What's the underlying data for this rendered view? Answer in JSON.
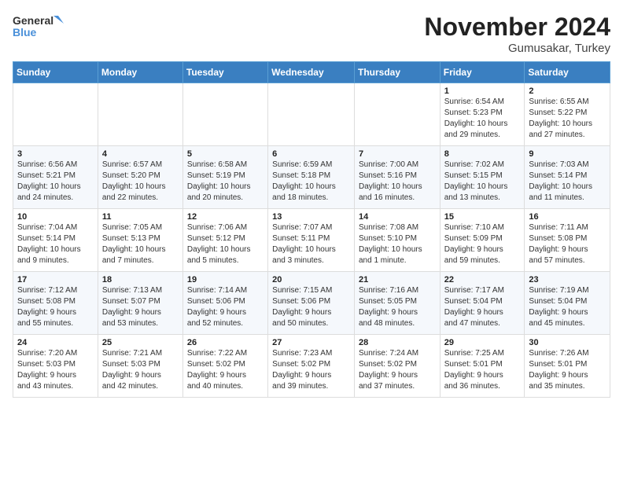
{
  "logo": {
    "line1": "General",
    "line2": "Blue"
  },
  "title": "November 2024",
  "subtitle": "Gumusakar, Turkey",
  "headers": [
    "Sunday",
    "Monday",
    "Tuesday",
    "Wednesday",
    "Thursday",
    "Friday",
    "Saturday"
  ],
  "weeks": [
    [
      {
        "day": "",
        "info": ""
      },
      {
        "day": "",
        "info": ""
      },
      {
        "day": "",
        "info": ""
      },
      {
        "day": "",
        "info": ""
      },
      {
        "day": "",
        "info": ""
      },
      {
        "day": "1",
        "info": "Sunrise: 6:54 AM\nSunset: 5:23 PM\nDaylight: 10 hours\nand 29 minutes."
      },
      {
        "day": "2",
        "info": "Sunrise: 6:55 AM\nSunset: 5:22 PM\nDaylight: 10 hours\nand 27 minutes."
      }
    ],
    [
      {
        "day": "3",
        "info": "Sunrise: 6:56 AM\nSunset: 5:21 PM\nDaylight: 10 hours\nand 24 minutes."
      },
      {
        "day": "4",
        "info": "Sunrise: 6:57 AM\nSunset: 5:20 PM\nDaylight: 10 hours\nand 22 minutes."
      },
      {
        "day": "5",
        "info": "Sunrise: 6:58 AM\nSunset: 5:19 PM\nDaylight: 10 hours\nand 20 minutes."
      },
      {
        "day": "6",
        "info": "Sunrise: 6:59 AM\nSunset: 5:18 PM\nDaylight: 10 hours\nand 18 minutes."
      },
      {
        "day": "7",
        "info": "Sunrise: 7:00 AM\nSunset: 5:16 PM\nDaylight: 10 hours\nand 16 minutes."
      },
      {
        "day": "8",
        "info": "Sunrise: 7:02 AM\nSunset: 5:15 PM\nDaylight: 10 hours\nand 13 minutes."
      },
      {
        "day": "9",
        "info": "Sunrise: 7:03 AM\nSunset: 5:14 PM\nDaylight: 10 hours\nand 11 minutes."
      }
    ],
    [
      {
        "day": "10",
        "info": "Sunrise: 7:04 AM\nSunset: 5:14 PM\nDaylight: 10 hours\nand 9 minutes."
      },
      {
        "day": "11",
        "info": "Sunrise: 7:05 AM\nSunset: 5:13 PM\nDaylight: 10 hours\nand 7 minutes."
      },
      {
        "day": "12",
        "info": "Sunrise: 7:06 AM\nSunset: 5:12 PM\nDaylight: 10 hours\nand 5 minutes."
      },
      {
        "day": "13",
        "info": "Sunrise: 7:07 AM\nSunset: 5:11 PM\nDaylight: 10 hours\nand 3 minutes."
      },
      {
        "day": "14",
        "info": "Sunrise: 7:08 AM\nSunset: 5:10 PM\nDaylight: 10 hours\nand 1 minute."
      },
      {
        "day": "15",
        "info": "Sunrise: 7:10 AM\nSunset: 5:09 PM\nDaylight: 9 hours\nand 59 minutes."
      },
      {
        "day": "16",
        "info": "Sunrise: 7:11 AM\nSunset: 5:08 PM\nDaylight: 9 hours\nand 57 minutes."
      }
    ],
    [
      {
        "day": "17",
        "info": "Sunrise: 7:12 AM\nSunset: 5:08 PM\nDaylight: 9 hours\nand 55 minutes."
      },
      {
        "day": "18",
        "info": "Sunrise: 7:13 AM\nSunset: 5:07 PM\nDaylight: 9 hours\nand 53 minutes."
      },
      {
        "day": "19",
        "info": "Sunrise: 7:14 AM\nSunset: 5:06 PM\nDaylight: 9 hours\nand 52 minutes."
      },
      {
        "day": "20",
        "info": "Sunrise: 7:15 AM\nSunset: 5:06 PM\nDaylight: 9 hours\nand 50 minutes."
      },
      {
        "day": "21",
        "info": "Sunrise: 7:16 AM\nSunset: 5:05 PM\nDaylight: 9 hours\nand 48 minutes."
      },
      {
        "day": "22",
        "info": "Sunrise: 7:17 AM\nSunset: 5:04 PM\nDaylight: 9 hours\nand 47 minutes."
      },
      {
        "day": "23",
        "info": "Sunrise: 7:19 AM\nSunset: 5:04 PM\nDaylight: 9 hours\nand 45 minutes."
      }
    ],
    [
      {
        "day": "24",
        "info": "Sunrise: 7:20 AM\nSunset: 5:03 PM\nDaylight: 9 hours\nand 43 minutes."
      },
      {
        "day": "25",
        "info": "Sunrise: 7:21 AM\nSunset: 5:03 PM\nDaylight: 9 hours\nand 42 minutes."
      },
      {
        "day": "26",
        "info": "Sunrise: 7:22 AM\nSunset: 5:02 PM\nDaylight: 9 hours\nand 40 minutes."
      },
      {
        "day": "27",
        "info": "Sunrise: 7:23 AM\nSunset: 5:02 PM\nDaylight: 9 hours\nand 39 minutes."
      },
      {
        "day": "28",
        "info": "Sunrise: 7:24 AM\nSunset: 5:02 PM\nDaylight: 9 hours\nand 37 minutes."
      },
      {
        "day": "29",
        "info": "Sunrise: 7:25 AM\nSunset: 5:01 PM\nDaylight: 9 hours\nand 36 minutes."
      },
      {
        "day": "30",
        "info": "Sunrise: 7:26 AM\nSunset: 5:01 PM\nDaylight: 9 hours\nand 35 minutes."
      }
    ]
  ]
}
